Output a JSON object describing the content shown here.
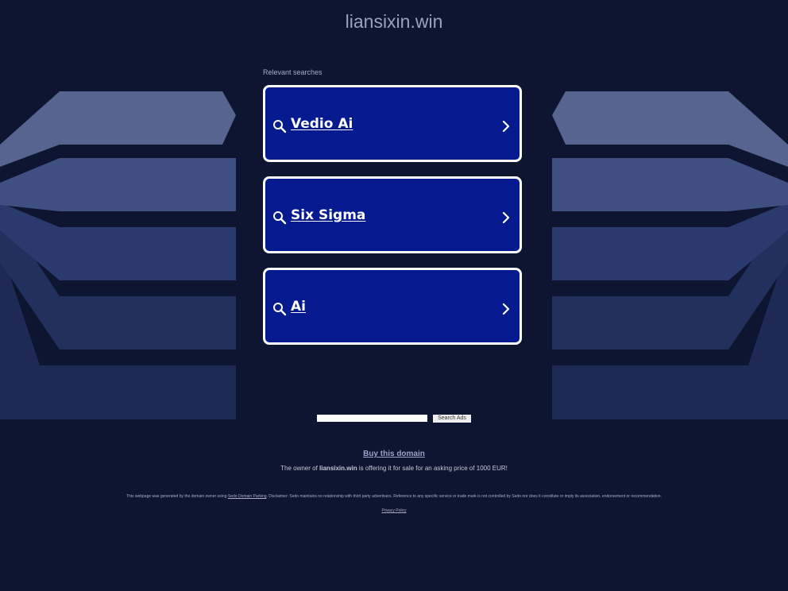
{
  "domain": "liansixin.win",
  "relevant_label": "Relevant searches",
  "searches": [
    {
      "label": "Vedio Ai"
    },
    {
      "label": "Six Sigma"
    },
    {
      "label": "Ai"
    }
  ],
  "ad_search": {
    "value": "",
    "button_label": "Search Ads"
  },
  "buy": {
    "link_label": "Buy this domain",
    "owner_prefix": "The owner of ",
    "owner_domain": "liansixin.win",
    "owner_suffix": " is offering it for sale for an asking price of 1000 EUR!"
  },
  "footer": {
    "disclaimer_prefix": "This webpage was generated by the domain owner using ",
    "parking_link": "Sedo Domain Parking",
    "disclaimer_suffix": ". Disclaimer: Sedo maintains no relationship with third party advertisers. Reference to any specific service or trade mark is not controlled by Sedo nor does it constitute or imply its association, endorsement or recommendation.",
    "privacy_label": "Privacy Policy"
  },
  "colors": {
    "background": "#0e1530",
    "card": "#041a8e",
    "card_border": "#ffffff"
  },
  "icons": {
    "search": "search-icon",
    "chevron": "chevron-right-icon"
  }
}
